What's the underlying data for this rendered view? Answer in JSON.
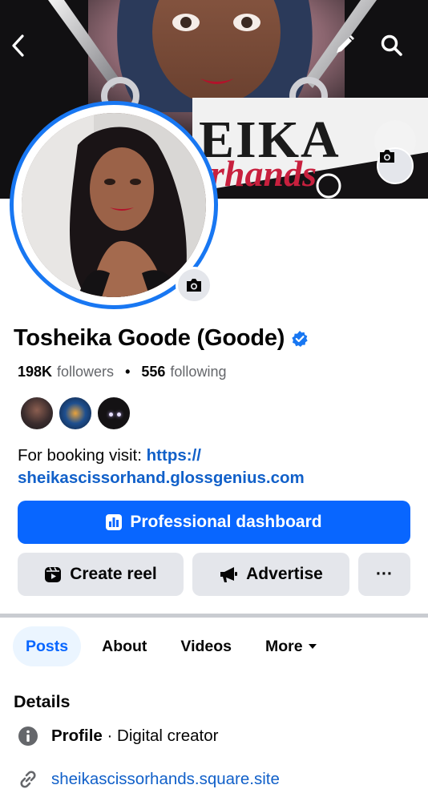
{
  "profile": {
    "name": "Tosheika Goode (Goode)",
    "followers_count": "198K",
    "followers_label": "followers",
    "following_count": "556",
    "following_label": "following",
    "bio_prefix": "For booking visit: ",
    "bio_link": "https://sheikascissorhand.glossgenius.com",
    "bio_link_line1": "https://",
    "bio_link_line2": "sheikascissorhand.glossgenius.com",
    "verified": true
  },
  "cover": {
    "text_top": "EIKA",
    "text_script": "rhands"
  },
  "icons": {
    "back": "chevron-left-icon",
    "edit": "pencil-icon",
    "search": "search-icon",
    "camera": "camera-icon",
    "verified": "verified-badge-icon"
  },
  "actions": {
    "dashboard_label": "Professional dashboard",
    "create_reel_label": "Create reel",
    "advertise_label": "Advertise",
    "more_label": "···"
  },
  "tabs": [
    {
      "label": "Posts",
      "active": true
    },
    {
      "label": "About",
      "active": false
    },
    {
      "label": "Videos",
      "active": false
    },
    {
      "label": "More",
      "active": false
    }
  ],
  "details": {
    "heading": "Details",
    "profile_label": "Profile",
    "profile_separator": " · ",
    "profile_category": "Digital creator",
    "website": "sheikascissorhands.square.site"
  },
  "colors": {
    "accent": "#0866ff",
    "link": "#1160c9",
    "secondary_bg": "#e4e6eb"
  }
}
